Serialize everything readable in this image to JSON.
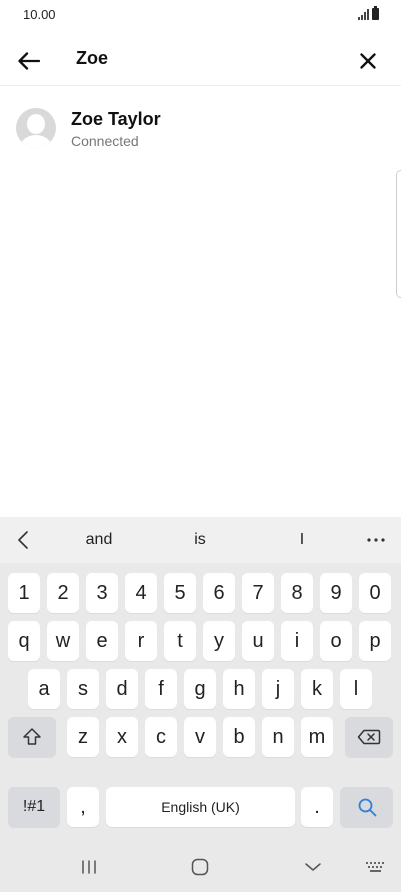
{
  "status_bar": {
    "time": "10.00"
  },
  "search": {
    "query": "Zoe"
  },
  "contact": {
    "name": "Zoe Taylor",
    "status": "Connected"
  },
  "keyboard": {
    "suggestions": [
      "and",
      "is",
      "I"
    ],
    "number_row": [
      "1",
      "2",
      "3",
      "4",
      "5",
      "6",
      "7",
      "8",
      "9",
      "0"
    ],
    "row1": [
      "q",
      "w",
      "e",
      "r",
      "t",
      "y",
      "u",
      "i",
      "o",
      "p"
    ],
    "row2": [
      "a",
      "s",
      "d",
      "f",
      "g",
      "h",
      "j",
      "k",
      "l"
    ],
    "row3": [
      "z",
      "x",
      "c",
      "v",
      "b",
      "n",
      "m"
    ],
    "symbols_label": "!#1",
    "comma": ",",
    "space_label": "English (UK)",
    "period": ".",
    "accent_color": "#2f7fd9"
  }
}
